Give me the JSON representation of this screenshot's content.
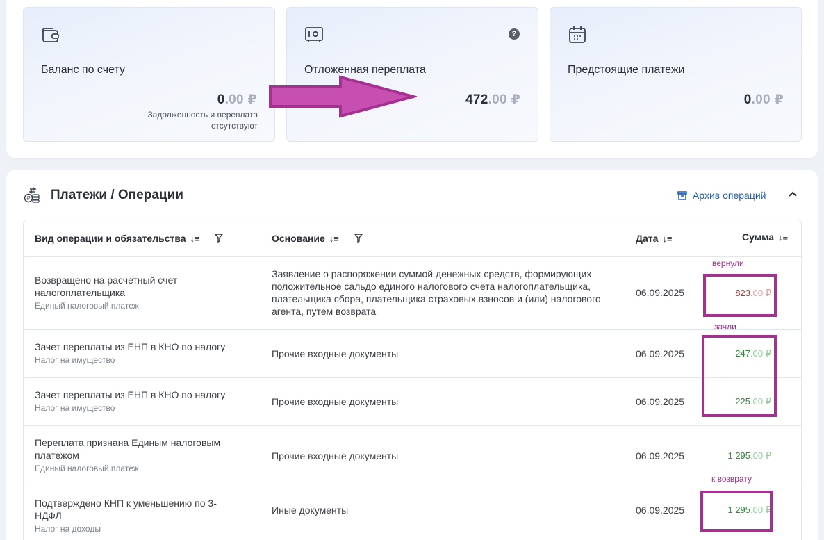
{
  "summary": {
    "balance": {
      "title": "Баланс по счету",
      "amount_int": "0",
      "amount_dec": ".00 ₽",
      "note": "Задолженность и переплата отсутствуют"
    },
    "deferred": {
      "title": "Отложенная переплата",
      "amount_int": "472",
      "amount_dec": ".00 ₽",
      "help": "?"
    },
    "upcoming": {
      "title": "Предстоящие платежи",
      "amount_int": "0",
      "amount_dec": ".00 ₽"
    }
  },
  "operations": {
    "title": "Платежи / Операции",
    "archive_label": "Архив операций",
    "columns": {
      "op": "Вид операции и обязательства",
      "basis": "Основание",
      "date": "Дата",
      "sum": "Сумма"
    },
    "rows": [
      {
        "op": "Возвращено на расчетный счет налогоплательщика",
        "op_sub": "Единый налоговый платеж",
        "basis": "Заявление о распоряжении суммой денежных средств, формирующих положительное сальдо единого налогового счета налогоплательщика, плательщика сбора, плательщика страховых взносов и (или) налогового агента, путем возврата",
        "date": "06.09.2025",
        "sum_int": "823",
        "sum_dec": ".00 ₽"
      },
      {
        "op": "Зачет переплаты из ЕНП в КНО по налогу",
        "op_sub": "Налог на имущество",
        "basis": "Прочие входные документы",
        "date": "06.09.2025",
        "sum_int": "247",
        "sum_dec": ".00 ₽"
      },
      {
        "op": "Зачет переплаты из ЕНП в КНО по налогу",
        "op_sub": "Налог на имущество",
        "basis": "Прочие входные документы",
        "date": "06.09.2025",
        "sum_int": "225",
        "sum_dec": ".00 ₽"
      },
      {
        "op": "Переплата признана Единым налоговым платежом",
        "op_sub": "Единый налоговый платеж",
        "basis": "Прочие входные документы",
        "date": "06.09.2025",
        "sum_int": "1 295",
        "sum_dec": ".00 ₽"
      },
      {
        "op": "Подтверждено КНП к уменьшению по 3-НДФЛ",
        "op_sub": "Налог на доходы",
        "basis": "Иные документы",
        "date": "06.09.2025",
        "sum_int": "1 295",
        "sum_dec": ".00 ₽"
      }
    ]
  },
  "annotations": {
    "returned": "вернули",
    "offset": "зачли",
    "to_refund": "к возврату",
    "color": "#a2318f"
  }
}
